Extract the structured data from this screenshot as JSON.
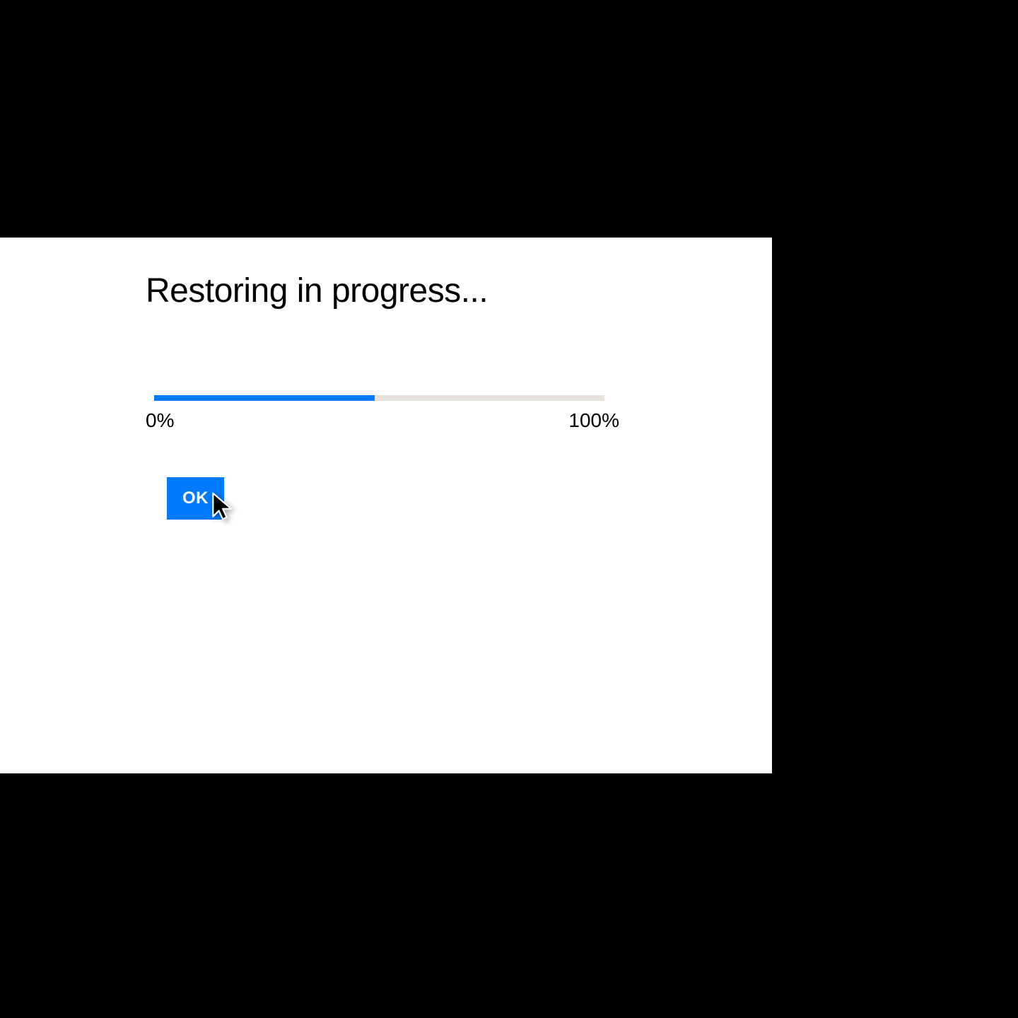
{
  "dialog": {
    "title": "Restoring in progress...",
    "progress": {
      "min_label": "0%",
      "max_label": "100%",
      "fill_percent": 49
    },
    "ok_label": "OK"
  },
  "colors": {
    "accent": "#007aff",
    "track": "#e6e2db",
    "background": "#000000",
    "panel": "#ffffff"
  }
}
